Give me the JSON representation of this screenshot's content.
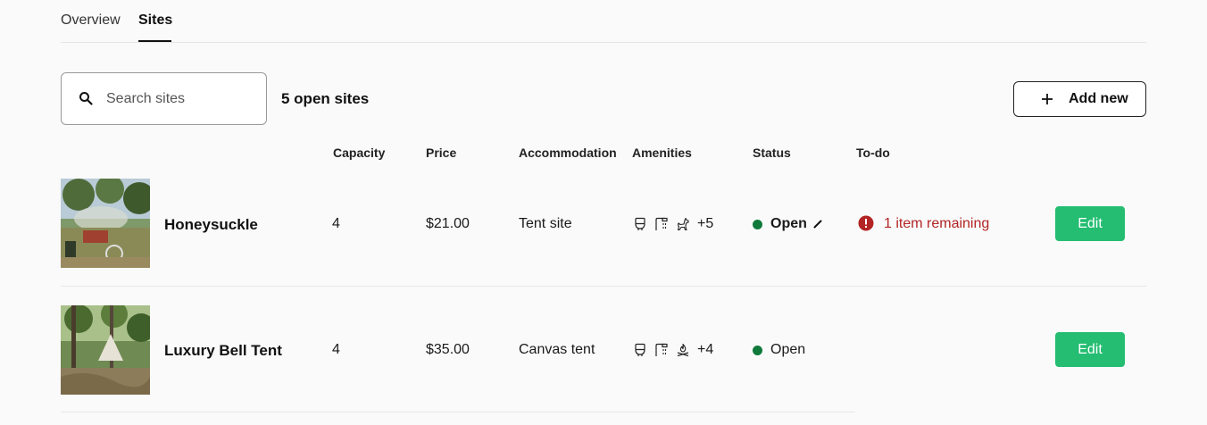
{
  "tabs": [
    {
      "label": "Overview"
    },
    {
      "label": "Sites"
    }
  ],
  "search": {
    "placeholder": "Search sites"
  },
  "open_count": "5 open sites",
  "add_button": {
    "label": "Add new"
  },
  "columns": {
    "capacity": "Capacity",
    "price": "Price",
    "accommodation": "Accommodation",
    "amenities": "Amenities",
    "status": "Status",
    "todo": "To-do"
  },
  "rows": [
    {
      "name": "Honeysuckle",
      "capacity": "4",
      "price": "$21.00",
      "accommodation": "Tent site",
      "amenities_icons": [
        "toilet-icon",
        "shower-icon",
        "pets-icon"
      ],
      "amenities_more": "+5",
      "status": "Open",
      "todo": "1 item remaining",
      "edit_label": "Edit"
    },
    {
      "name": "Luxury Bell Tent",
      "capacity": "4",
      "price": "$35.00",
      "accommodation": "Canvas tent",
      "amenities_icons": [
        "toilet-icon",
        "shower-icon",
        "campfire-icon"
      ],
      "amenities_more": "+4",
      "status": "Open",
      "todo": "",
      "edit_label": "Edit"
    }
  ],
  "colors": {
    "status_open": "#0f7a3a",
    "todo_alert": "#b32424",
    "edit_button": "#24bd72"
  }
}
